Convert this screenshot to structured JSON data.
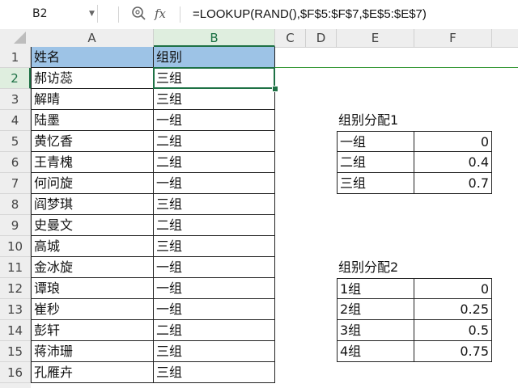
{
  "formula_bar": {
    "name_box": "B2",
    "zoom_icon": "magnifier-icon",
    "fx_label": "fx",
    "formula": "=LOOKUP(RAND(),$F$5:$F$7,$E$5:$E$7)"
  },
  "columns": [
    "A",
    "B",
    "C",
    "D",
    "E",
    "F"
  ],
  "selected_column": "B",
  "rows": [
    "1",
    "2",
    "3",
    "4",
    "5",
    "6",
    "7",
    "8",
    "9",
    "10",
    "11",
    "12",
    "13",
    "14",
    "15",
    "16"
  ],
  "selected_row": "2",
  "table": {
    "headers": [
      "姓名",
      "组别"
    ],
    "records": [
      [
        "郝访蕊",
        "三组"
      ],
      [
        "解晴",
        "三组"
      ],
      [
        "陆墨",
        "一组"
      ],
      [
        "黄忆香",
        "二组"
      ],
      [
        "王青槐",
        "二组"
      ],
      [
        "何问旋",
        "一组"
      ],
      [
        "阎梦琪",
        "三组"
      ],
      [
        "史曼文",
        "二组"
      ],
      [
        "高城",
        "三组"
      ],
      [
        "金冰旋",
        "一组"
      ],
      [
        "谭琅",
        "一组"
      ],
      [
        "崔秒",
        "一组"
      ],
      [
        "彭轩",
        "二组"
      ],
      [
        "蒋沛珊",
        "三组"
      ],
      [
        "孔雁卉",
        "三组"
      ]
    ]
  },
  "group_table_1": {
    "title": "组别分配1",
    "rows": [
      [
        "一组",
        "0"
      ],
      [
        "二组",
        "0.4"
      ],
      [
        "三组",
        "0.7"
      ]
    ]
  },
  "group_table_2": {
    "title": "组别分配2",
    "rows": [
      [
        "1组",
        "0"
      ],
      [
        "2组",
        "0.25"
      ],
      [
        "3组",
        "0.5"
      ],
      [
        "4组",
        "0.75"
      ]
    ]
  },
  "colors": {
    "header_fill": "#9dc3e6",
    "selection": "#1e7145"
  }
}
